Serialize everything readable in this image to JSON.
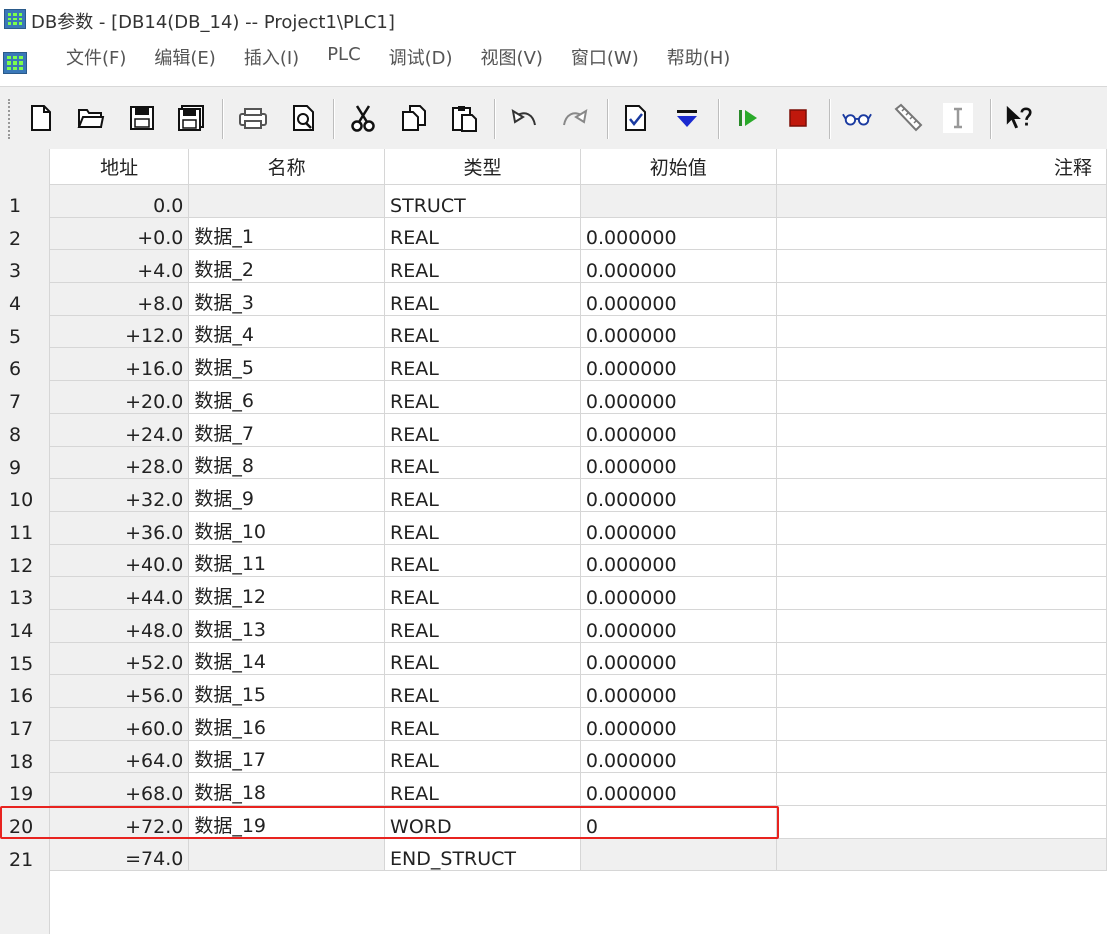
{
  "window": {
    "title": "DB参数 - [DB14(DB_14) -- Project1\\PLC1]"
  },
  "menu": {
    "items": [
      "文件(F)",
      "编辑(E)",
      "插入(I)",
      "PLC",
      "调试(D)",
      "视图(V)",
      "窗口(W)",
      "帮助(H)"
    ]
  },
  "toolbar": {
    "buttons": [
      "new-icon",
      "open-icon",
      "save-icon",
      "save-all-icon",
      "print-icon",
      "print-preview-icon",
      "cut-icon",
      "copy-icon",
      "paste-icon",
      "undo-icon",
      "redo-icon",
      "check-icon",
      "download-icon",
      "run-icon",
      "stop-icon",
      "glasses-icon",
      "ruler-icon",
      "text-cursor-icon",
      "help-icon"
    ]
  },
  "table": {
    "headers": {
      "address": "地址",
      "name": "名称",
      "type": "类型",
      "initial": "初始值",
      "comment": "注释"
    },
    "rows": [
      {
        "n": "1",
        "address": "0.0",
        "name": "",
        "type": "STRUCT",
        "initial": "",
        "comment": "",
        "struct": true
      },
      {
        "n": "2",
        "address": "+0.0",
        "name": "数据_1",
        "type": "REAL",
        "initial": "0.000000",
        "comment": ""
      },
      {
        "n": "3",
        "address": "+4.0",
        "name": "数据_2",
        "type": "REAL",
        "initial": "0.000000",
        "comment": ""
      },
      {
        "n": "4",
        "address": "+8.0",
        "name": "数据_3",
        "type": "REAL",
        "initial": "0.000000",
        "comment": ""
      },
      {
        "n": "5",
        "address": "+12.0",
        "name": "数据_4",
        "type": "REAL",
        "initial": "0.000000",
        "comment": ""
      },
      {
        "n": "6",
        "address": "+16.0",
        "name": "数据_5",
        "type": "REAL",
        "initial": "0.000000",
        "comment": ""
      },
      {
        "n": "7",
        "address": "+20.0",
        "name": "数据_6",
        "type": "REAL",
        "initial": "0.000000",
        "comment": ""
      },
      {
        "n": "8",
        "address": "+24.0",
        "name": "数据_7",
        "type": "REAL",
        "initial": "0.000000",
        "comment": ""
      },
      {
        "n": "9",
        "address": "+28.0",
        "name": "数据_8",
        "type": "REAL",
        "initial": "0.000000",
        "comment": ""
      },
      {
        "n": "10",
        "address": "+32.0",
        "name": "数据_9",
        "type": "REAL",
        "initial": "0.000000",
        "comment": ""
      },
      {
        "n": "11",
        "address": "+36.0",
        "name": "数据_10",
        "type": "REAL",
        "initial": "0.000000",
        "comment": ""
      },
      {
        "n": "12",
        "address": "+40.0",
        "name": "数据_11",
        "type": "REAL",
        "initial": "0.000000",
        "comment": ""
      },
      {
        "n": "13",
        "address": "+44.0",
        "name": "数据_12",
        "type": "REAL",
        "initial": "0.000000",
        "comment": ""
      },
      {
        "n": "14",
        "address": "+48.0",
        "name": "数据_13",
        "type": "REAL",
        "initial": "0.000000",
        "comment": ""
      },
      {
        "n": "15",
        "address": "+52.0",
        "name": "数据_14",
        "type": "REAL",
        "initial": "0.000000",
        "comment": ""
      },
      {
        "n": "16",
        "address": "+56.0",
        "name": "数据_15",
        "type": "REAL",
        "initial": "0.000000",
        "comment": ""
      },
      {
        "n": "17",
        "address": "+60.0",
        "name": "数据_16",
        "type": "REAL",
        "initial": "0.000000",
        "comment": ""
      },
      {
        "n": "18",
        "address": "+64.0",
        "name": "数据_17",
        "type": "REAL",
        "initial": "0.000000",
        "comment": ""
      },
      {
        "n": "19",
        "address": "+68.0",
        "name": "数据_18",
        "type": "REAL",
        "initial": "0.000000",
        "comment": ""
      },
      {
        "n": "20",
        "address": "+72.0",
        "name": "数据_19",
        "type": "WORD",
        "initial": "0",
        "comment": "",
        "highlighted": true
      },
      {
        "n": "21",
        "address": "=74.0",
        "name": "",
        "type": "END_STRUCT",
        "initial": "",
        "comment": "",
        "struct": true
      }
    ]
  },
  "colors": {
    "highlight": "#e8231f",
    "struct_row_bg": "#f0f0f0",
    "grid_line": "#d6d6d6"
  }
}
